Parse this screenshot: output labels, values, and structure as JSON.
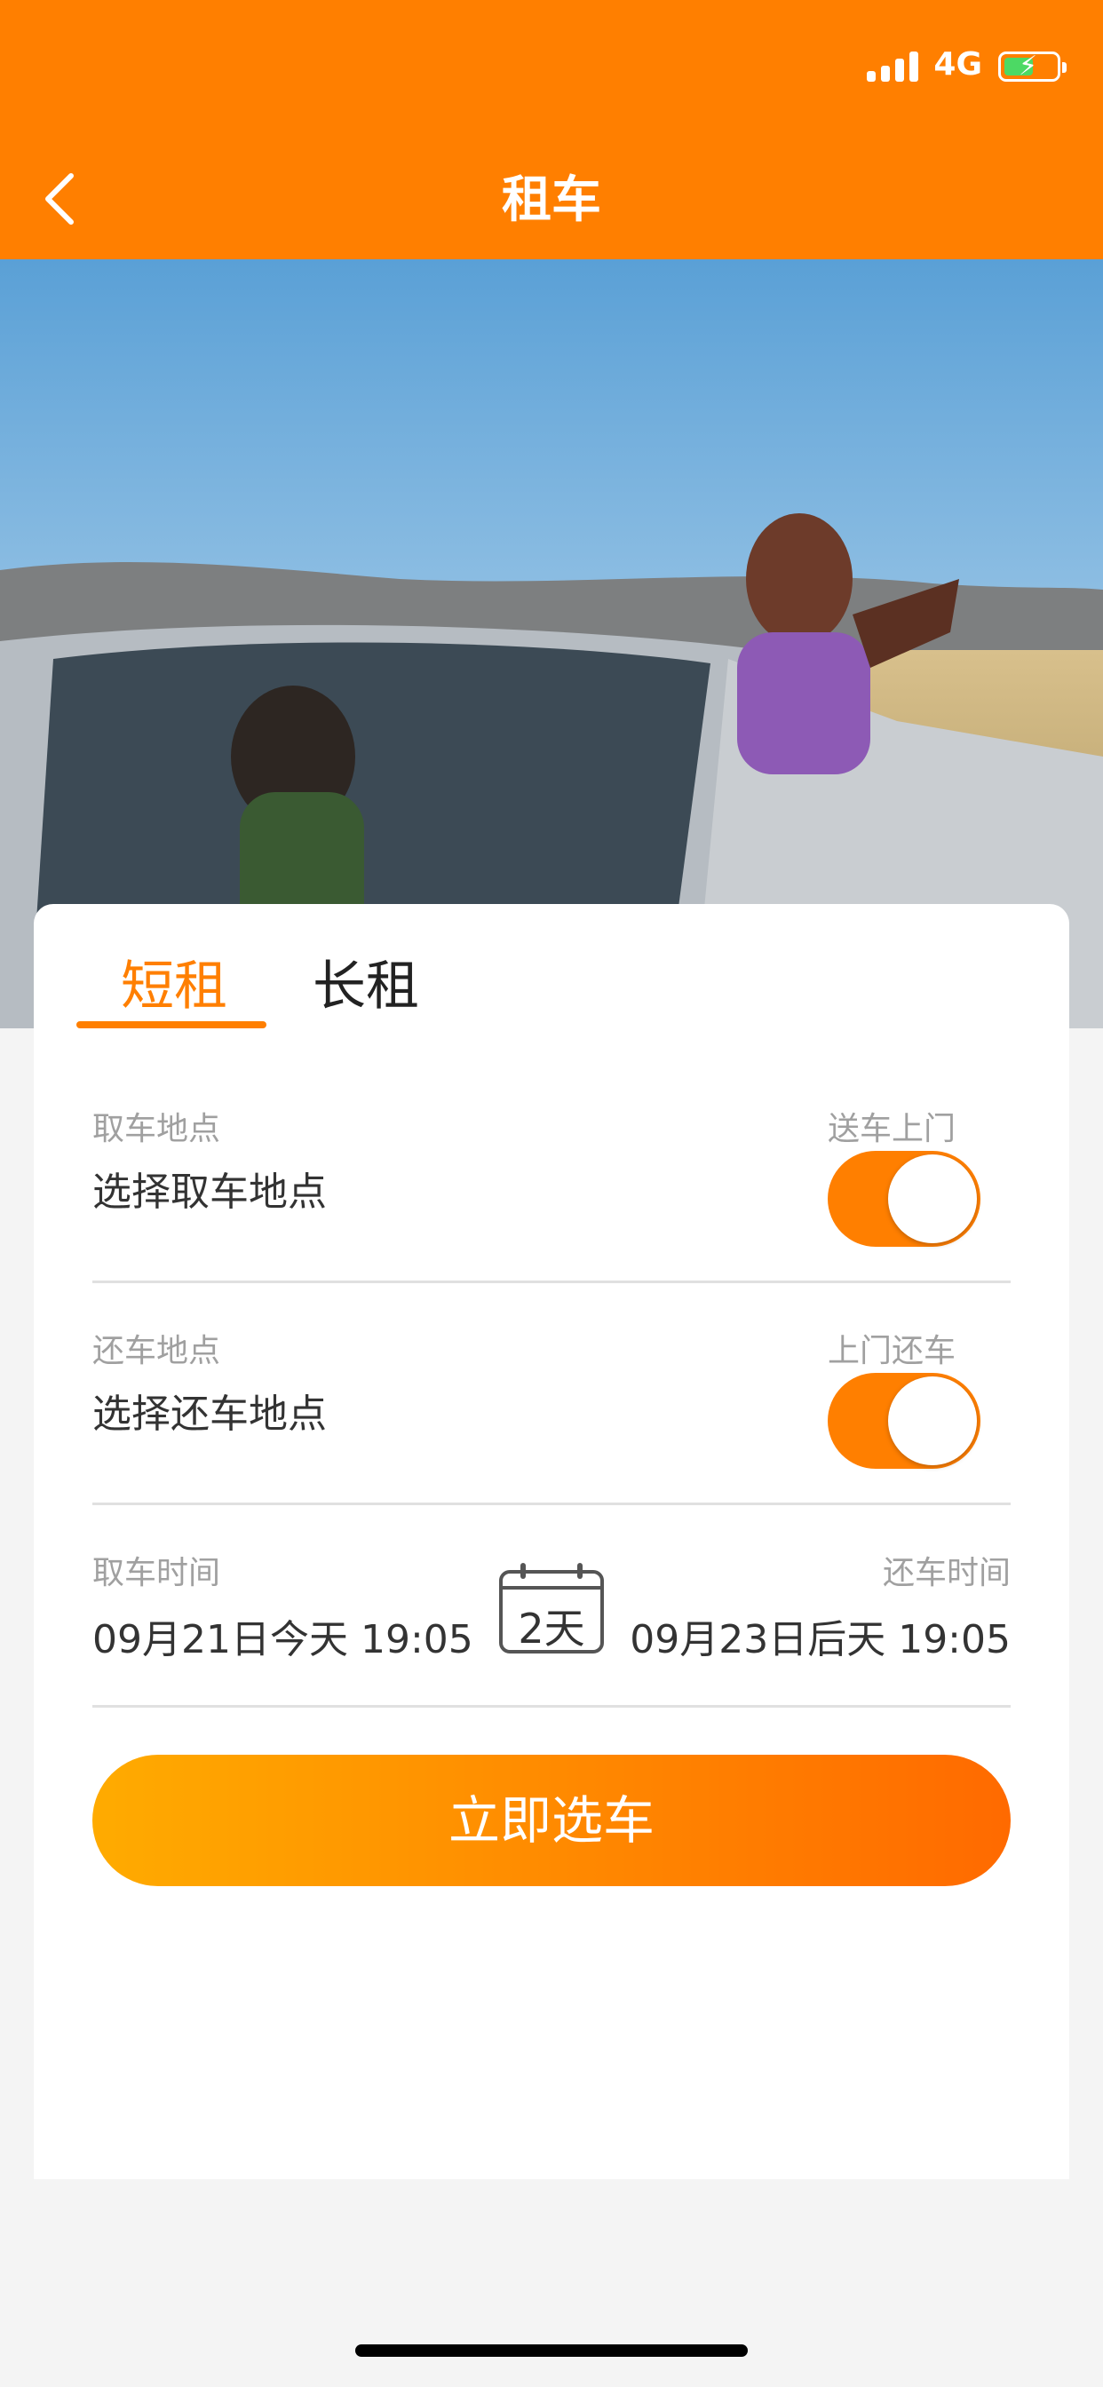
{
  "status_bar": {
    "network": "4G"
  },
  "nav": {
    "title": "租车",
    "back_icon": "chevron-left-icon"
  },
  "tabs": [
    {
      "label": "短租",
      "active": true
    },
    {
      "label": "长租",
      "active": false
    }
  ],
  "pickup": {
    "label": "取车地点",
    "value": "选择取车地点",
    "toggle_label": "送车上门",
    "toggle_on": true
  },
  "return": {
    "label": "还车地点",
    "value": "选择还车地点",
    "toggle_label": "上门还车",
    "toggle_on": true
  },
  "time": {
    "pickup_label": "取车时间",
    "pickup_value": "09月21日今天 19:05",
    "return_label": "还车时间",
    "return_value": "09月23日后天 19:05",
    "duration": "2天"
  },
  "cta_label": "立即选车",
  "colors": {
    "accent": "#ff7f00",
    "gradient_start": "#ffab00",
    "gradient_end": "#ff6a00"
  }
}
